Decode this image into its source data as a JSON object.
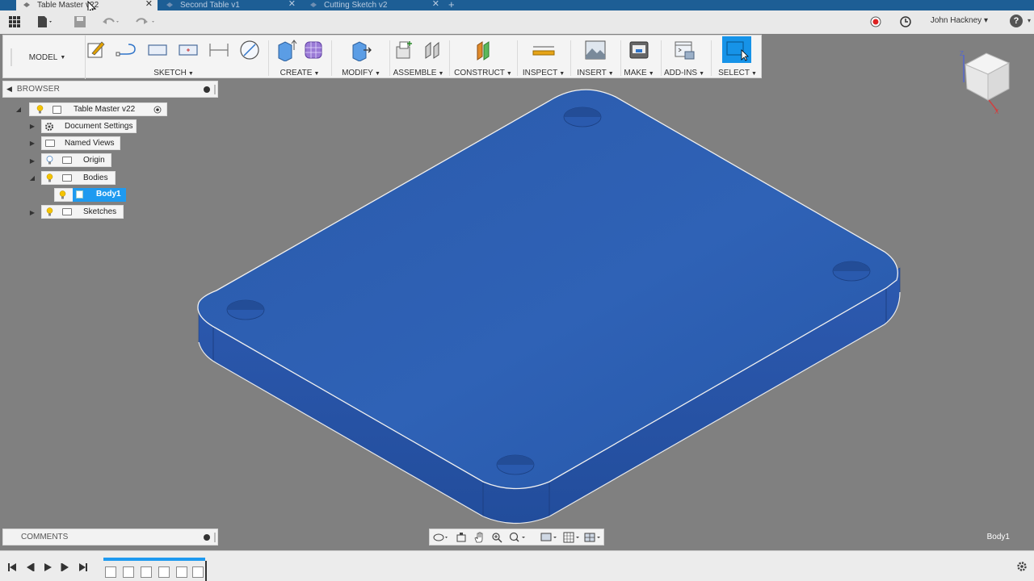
{
  "tabs": [
    {
      "label": "Table Master v22",
      "active": true
    },
    {
      "label": "Second Table v1",
      "active": false
    },
    {
      "label": "Cutting Sketch v2",
      "active": false
    }
  ],
  "user": {
    "name": "John Hackney"
  },
  "workspace": {
    "label": "MODEL"
  },
  "toolbar": {
    "groups": [
      {
        "label": "SKETCH"
      },
      {
        "label": "CREATE"
      },
      {
        "label": "MODIFY"
      },
      {
        "label": "ASSEMBLE"
      },
      {
        "label": "CONSTRUCT"
      },
      {
        "label": "INSPECT"
      },
      {
        "label": "INSERT"
      },
      {
        "label": "MAKE"
      },
      {
        "label": "ADD-INS"
      },
      {
        "label": "SELECT"
      }
    ]
  },
  "browser": {
    "title": "BROWSER",
    "root": "Table Master v22",
    "items": [
      {
        "label": "Document Settings"
      },
      {
        "label": "Named Views"
      },
      {
        "label": "Origin"
      },
      {
        "label": "Bodies"
      },
      {
        "label": "Body1"
      },
      {
        "label": "Sketches"
      }
    ]
  },
  "comments": {
    "title": "COMMENTS"
  },
  "status": {
    "selection": "Body1"
  },
  "colors": {
    "body_blue": "#2a5aaf",
    "accent": "#1e9af0",
    "tabbar": "#1d5e95"
  }
}
